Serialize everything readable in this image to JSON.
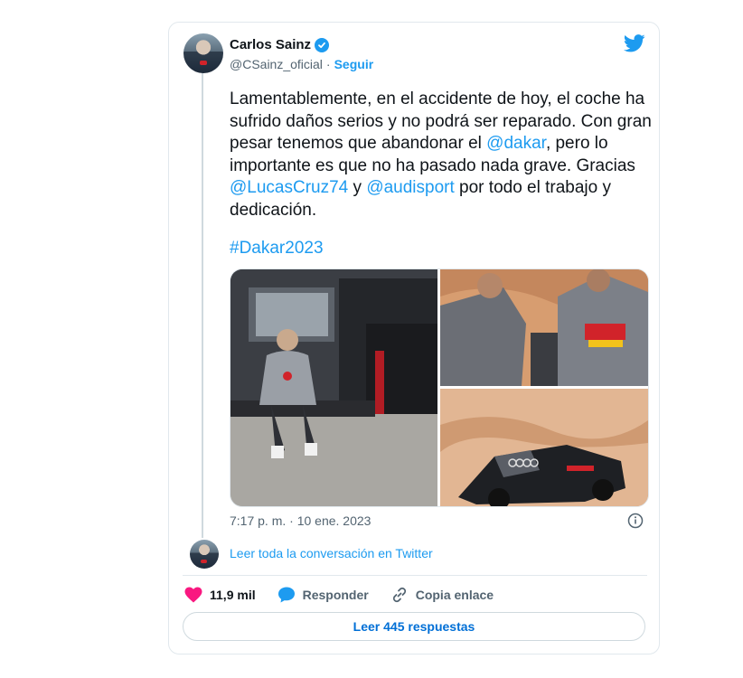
{
  "author": {
    "name": "Carlos Sainz",
    "handle": "@CSainz_oficial",
    "separator": "·",
    "follow_label": "Seguir"
  },
  "tweet": {
    "text_parts": [
      "Lamentablemente, en el accidente de hoy, el coche ha sufrido daños serios y no podrá ser reparado. Con gran pesar tenemos que abandonar el ",
      "@dakar",
      ", pero lo importante es que no ha pasado nada grave. Gracias ",
      "@LucasCruz74",
      " y ",
      "@audisport",
      " por todo el trabajo y dedicación."
    ],
    "hashtag": "#Dakar2023",
    "timestamp": "7:17 p. m. · 10 ene. 2023"
  },
  "thread": {
    "read_conversation": "Leer toda la conversación en Twitter"
  },
  "actions": {
    "likes": "11,9 mil",
    "reply": "Responder",
    "copy_link": "Copia enlace",
    "read_replies": "Leer 445 respuestas"
  },
  "icons": {
    "brand": "twitter-bird-icon",
    "verified": "verified-badge-icon",
    "info": "info-icon",
    "like": "heart-icon",
    "reply": "speech-bubble-icon",
    "link": "link-icon"
  },
  "colors": {
    "accent": "#1d9bf0",
    "heart": "#f91880",
    "text": "#0f1419",
    "muted": "#536471"
  }
}
